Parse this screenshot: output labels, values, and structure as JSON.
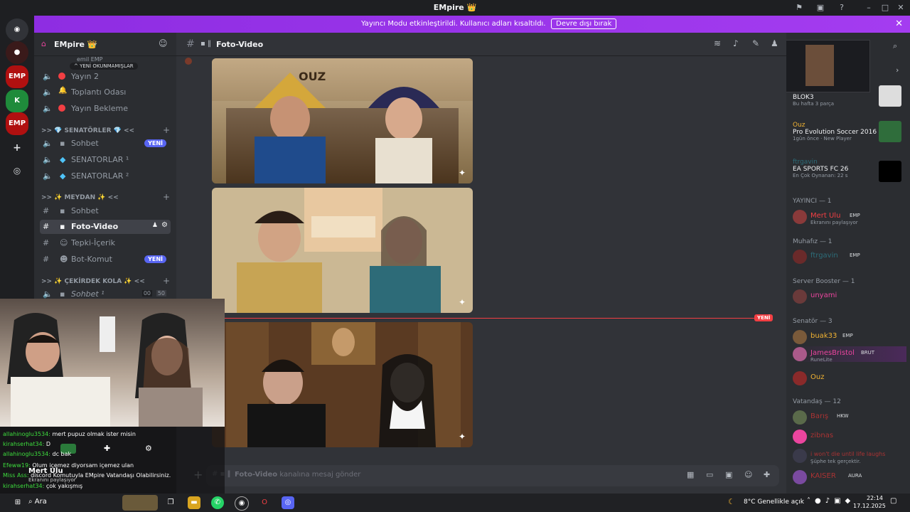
{
  "window": {
    "title": "EMpire 👑"
  },
  "banner": {
    "message": "Yayıncı Modu etkinleştirildi. Kullanıcı adları kısaltıldı.",
    "button": "Devre dışı bırak"
  },
  "server": {
    "name": "EMpire 👑",
    "unread_pill": "^ YENİ OKUNMAMIŞLAR",
    "top_user": "emil",
    "top_user_tag": "EMP"
  },
  "channels": [
    {
      "name": "Yayın 2",
      "icon": "speaker-icon"
    },
    {
      "name": "Toplantı Odası",
      "icon": "speaker-icon"
    },
    {
      "name": "Yayın Bekleme",
      "icon": "speaker-icon"
    }
  ],
  "categories": {
    "senatorler": ">> 💎 SENATÖRLER 💎 <<",
    "meydan": ">> ✨ MEYDAN ✨ <<",
    "cekirdek": ">> ✨ ÇEKİRDEK KOLA ✨ <<"
  },
  "senator_channels": [
    {
      "name": "Sohbet",
      "badge": "YENİ"
    },
    {
      "name": "SENATORLAR ¹",
      "badge": ""
    },
    {
      "name": "SENATORLAR ²",
      "badge": ""
    }
  ],
  "meydan_channels": [
    {
      "name": "Sohbet",
      "badge": ""
    },
    {
      "name": "Foto-Video",
      "badge": ""
    },
    {
      "name": "Tepki-İçerik",
      "badge": ""
    },
    {
      "name": "Bot-Komut",
      "badge": "YENİ"
    }
  ],
  "cekirdek_channels": [
    {
      "name": "Sohbet ¹",
      "count_a": "00",
      "count_b": "50"
    }
  ],
  "channel_header": {
    "name": "Foto-Video"
  },
  "main": {
    "new_marker": "YENİ",
    "composer_channel": "Foto-Video",
    "composer_placeholder": "kanalına mesaj gönder",
    "image_caption": "OUZ"
  },
  "members": {
    "activities": [
      {
        "title": "BLOK3",
        "sub": "Bu hafta 3 parça"
      },
      {
        "user": "Ouz",
        "title": "Pro Evolution Soccer 2016 ...",
        "sub": "1gün önce · New Player"
      },
      {
        "user": "ftrgavin",
        "title": "EA SPORTS FC 26",
        "sub": "En Çok Oynanan: 22 s"
      }
    ],
    "groups": [
      {
        "label": "YAYINCI — 1",
        "members": [
          {
            "name": "Mert Ulu",
            "tag": "EMP",
            "sub": "Ekranını paylaşıyor",
            "color": "#f23f43"
          }
        ]
      },
      {
        "label": "Muhafız — 1",
        "members": [
          {
            "name": "ftrgavin",
            "tag": "EMP",
            "color": "#2c6c78"
          }
        ]
      },
      {
        "label": "Server Booster — 1",
        "members": [
          {
            "name": "unyami",
            "tag": "",
            "color": "#eb459e"
          }
        ]
      },
      {
        "label": "Senatör — 3",
        "members": [
          {
            "name": "buak33",
            "tag": "EMP",
            "color": "#f0b232"
          },
          {
            "name": "JamesBristol",
            "tag": "BRUT",
            "sub": "RuneLite",
            "color": "#eb459e"
          },
          {
            "name": "Ouz",
            "tag": "",
            "color": "#f0b232"
          }
        ]
      },
      {
        "label": "Vatandaş — 12",
        "members": [
          {
            "name": "Barış",
            "tag": "HKW",
            "color": "#a33"
          },
          {
            "name": "zibnas",
            "tag": "",
            "color": "#a33"
          },
          {
            "name": "i won't die until life laughs",
            "tag": "",
            "sub": "Şüphe tek gerçektir.",
            "color": "#a33"
          },
          {
            "name": "KAISER",
            "tag": "AURA",
            "color": "#a33"
          }
        ]
      }
    ]
  },
  "overlay": {
    "streamer_name": "Mert Ulu",
    "streamer_sub": "Ekranını paylaşıyor",
    "chat": [
      {
        "user": "allahinoglu3534:",
        "text": "mert pupuz olmak ister misin"
      },
      {
        "user": "kirahserhat34:",
        "text": "D"
      },
      {
        "user": "allahinoglu3534:",
        "text": "dc bak"
      },
      {
        "user": "Efeww19:",
        "text": "Olum içemez diyorsam içemez ulan"
      },
      {
        "user": "Miss Ass:",
        "text": "discord Komutuyla EMpire Vatandaşı Olabilirsiniz."
      },
      {
        "user": "kirahserhat34:",
        "text": "çok yakışmış"
      },
      {
        "user": "Efeww19:",
        "text": ""
      }
    ]
  },
  "taskbar": {
    "search": "Ara",
    "weather": "8°C Genellikle açık",
    "time": "22:14",
    "date": "17.12.2025"
  },
  "colors": {
    "accent": "#5865f2",
    "banner": "#9b30ff",
    "danger": "#f23f43"
  }
}
